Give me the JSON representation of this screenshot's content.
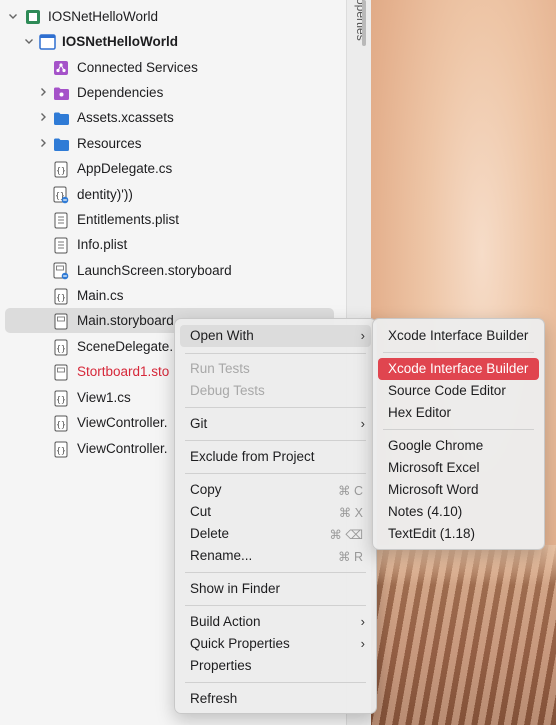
{
  "tree": {
    "items": [
      {
        "label": "IOSNetHelloWorld",
        "icon": "solution-icon"
      },
      {
        "label": "IOSNetHelloWorld",
        "icon": "project-icon"
      },
      {
        "label": "Connected Services",
        "icon": "connected-services-icon"
      },
      {
        "label": "Dependencies",
        "icon": "dependencies-folder-icon"
      },
      {
        "label": "Assets.xcassets",
        "icon": "folder-icon"
      },
      {
        "label": "Resources",
        "icon": "folder-icon"
      },
      {
        "label": "AppDelegate.cs",
        "icon": "csharp-file-icon"
      },
      {
        "label": "dentity)'))",
        "icon": "file-badge-icon"
      },
      {
        "label": "Entitlements.plist",
        "icon": "plist-file-icon"
      },
      {
        "label": "Info.plist",
        "icon": "plist-file-icon"
      },
      {
        "label": "LaunchScreen.storyboard",
        "icon": "storyboard-file-icon"
      },
      {
        "label": "Main.cs",
        "icon": "csharp-file-icon"
      },
      {
        "label": "Main.storyboard",
        "icon": "storyboard-file-icon"
      },
      {
        "label": "SceneDelegate.",
        "icon": "csharp-file-icon"
      },
      {
        "label": "Stortboard1.sto",
        "icon": "storyboard-file-icon"
      },
      {
        "label": "View1.cs",
        "icon": "csharp-file-icon"
      },
      {
        "label": "ViewController.",
        "icon": "csharp-file-icon"
      },
      {
        "label": "ViewController.",
        "icon": "csharp-file-icon"
      }
    ]
  },
  "properties_tab": "operties",
  "context_menu": {
    "open_with": "Open With",
    "run_tests": "Run Tests",
    "debug_tests": "Debug Tests",
    "git": "Git",
    "exclude": "Exclude from Project",
    "copy": "Copy",
    "copy_sc": "⌘ C",
    "cut": "Cut",
    "cut_sc": "⌘ X",
    "delete": "Delete",
    "delete_sc": "⌘ ⌫",
    "rename": "Rename...",
    "rename_sc": "⌘ R",
    "show_in_finder": "Show in Finder",
    "build_action": "Build Action",
    "quick_properties": "Quick Properties",
    "properties": "Properties",
    "refresh": "Refresh"
  },
  "submenu": {
    "default_app": "Xcode Interface Builder",
    "xcode_ib": "Xcode Interface Builder",
    "source_editor": "Source Code Editor",
    "hex_editor": "Hex Editor",
    "chrome": "Google Chrome",
    "excel": "Microsoft Excel",
    "word": "Microsoft Word",
    "notes": "Notes (4.10)",
    "textedit": "TextEdit (1.18)"
  },
  "colors": {
    "highlight": "#e0454f",
    "error_text": "#d6283a",
    "folder": "#2f7bd6"
  }
}
